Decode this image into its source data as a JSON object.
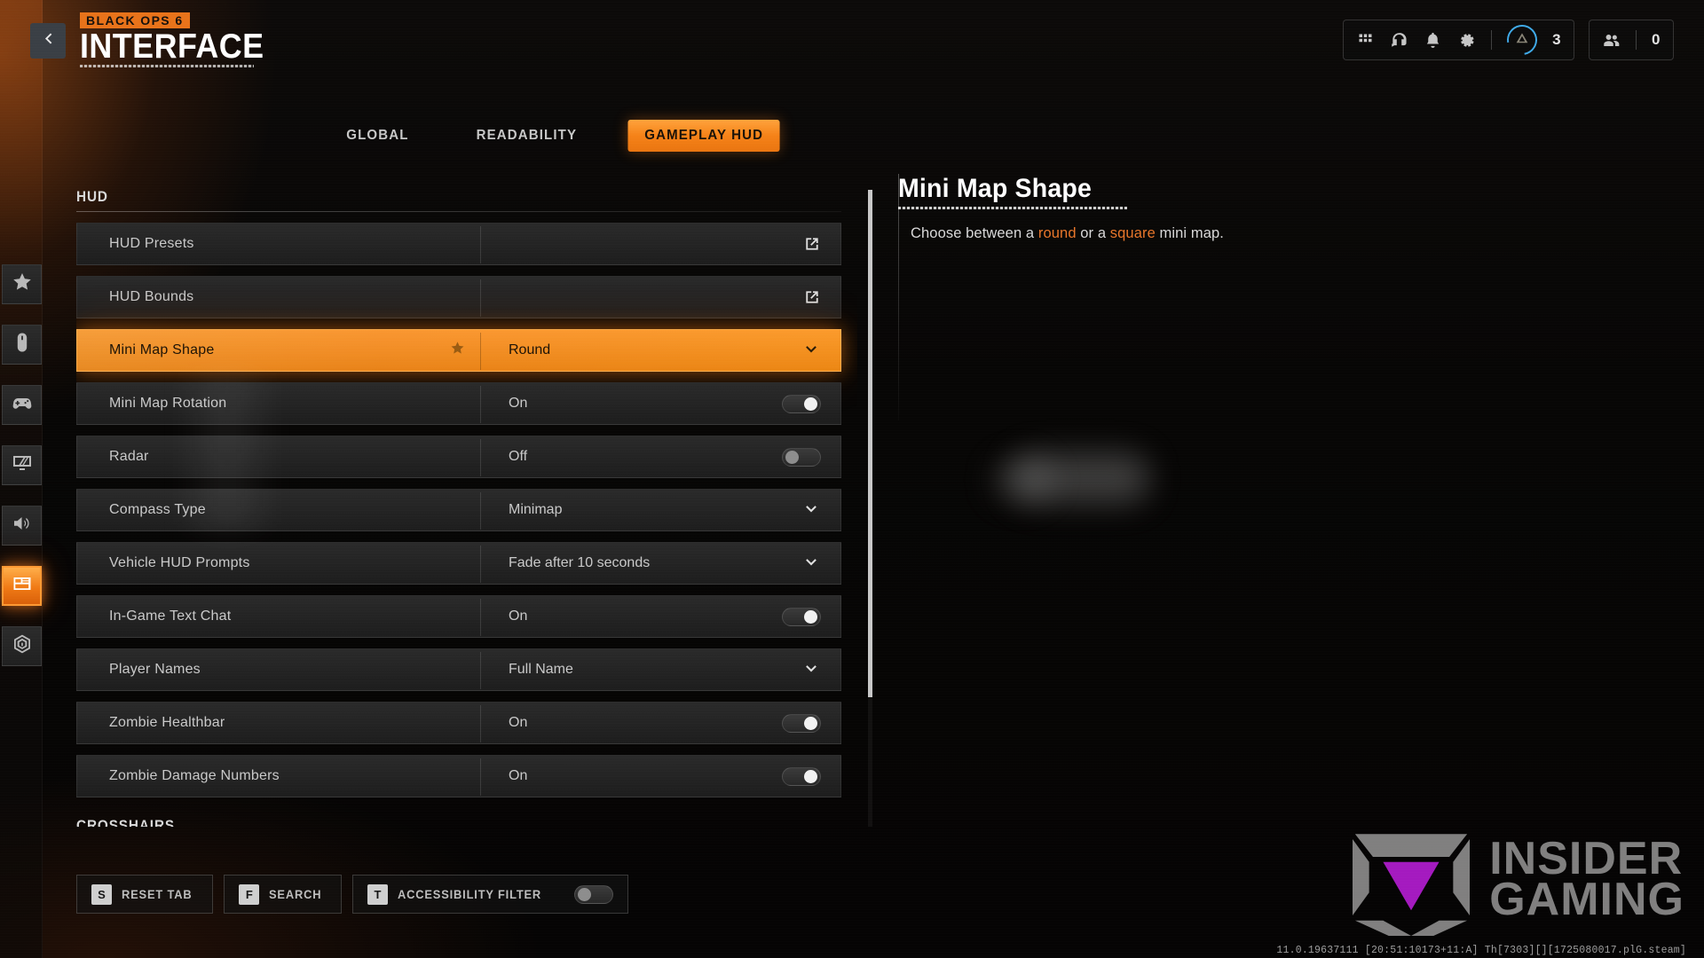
{
  "header": {
    "back_icon": "chevron-left-icon",
    "game_badge": "BLACK OPS 6",
    "page_title": "INTERFACE"
  },
  "top_right": {
    "icons": [
      {
        "name": "apps-grid-icon"
      },
      {
        "name": "headset-chat-icon"
      },
      {
        "name": "bell-notifications-icon"
      },
      {
        "name": "gear-settings-icon"
      }
    ],
    "battlepass_count": "3",
    "battlepass_icon": "battlepass-tier-icon",
    "friends_icon": "friends-people-icon",
    "friends_count": "0"
  },
  "tabs": [
    {
      "label": "GLOBAL",
      "active": false
    },
    {
      "label": "READABILITY",
      "active": false
    },
    {
      "label": "GAMEPLAY HUD",
      "active": true
    }
  ],
  "sidebar": {
    "items": [
      {
        "icon": "star-favorites-icon",
        "active": false
      },
      {
        "icon": "mouse-keyboard-icon",
        "active": false
      },
      {
        "icon": "controller-gamepad-icon",
        "active": false
      },
      {
        "icon": "monitor-graphics-icon",
        "active": false
      },
      {
        "icon": "speaker-audio-icon",
        "active": false
      },
      {
        "icon": "interface-layout-icon",
        "active": true
      },
      {
        "icon": "telemetry-radar-icon",
        "active": false
      }
    ]
  },
  "settings": {
    "section_title": "HUD",
    "next_section_title": "CROSSHAIRS",
    "rows": [
      {
        "label": "HUD Presets",
        "value": "",
        "control": "external-link",
        "starred": false,
        "highlight": false
      },
      {
        "label": "HUD Bounds",
        "value": "",
        "control": "external-link",
        "starred": false,
        "highlight": false
      },
      {
        "label": "Mini Map Shape",
        "value": "Round",
        "control": "dropdown",
        "starred": true,
        "highlight": true
      },
      {
        "label": "Mini Map Rotation",
        "value": "On",
        "control": "toggle-on",
        "starred": false,
        "highlight": false
      },
      {
        "label": "Radar",
        "value": "Off",
        "control": "toggle-off",
        "starred": false,
        "highlight": false
      },
      {
        "label": "Compass Type",
        "value": "Minimap",
        "control": "dropdown",
        "starred": false,
        "highlight": false
      },
      {
        "label": "Vehicle HUD Prompts",
        "value": "Fade after 10 seconds",
        "control": "dropdown",
        "starred": false,
        "highlight": false
      },
      {
        "label": "In-Game Text Chat",
        "value": "On",
        "control": "toggle-on",
        "starred": false,
        "highlight": false
      },
      {
        "label": "Player Names",
        "value": "Full Name",
        "control": "dropdown",
        "starred": false,
        "highlight": false
      },
      {
        "label": "Zombie Healthbar",
        "value": "On",
        "control": "toggle-on",
        "starred": false,
        "highlight": false
      },
      {
        "label": "Zombie Damage Numbers",
        "value": "On",
        "control": "toggle-on",
        "starred": false,
        "highlight": false
      }
    ]
  },
  "detail": {
    "title": "Mini Map Shape",
    "desc_pre": "Choose between a ",
    "desc_hl1": "round",
    "desc_mid": " or a ",
    "desc_hl2": "square",
    "desc_post": " mini map."
  },
  "bottom_bar": {
    "reset": {
      "key": "S",
      "label": "RESET TAB"
    },
    "search": {
      "key": "F",
      "label": "SEARCH"
    },
    "accessibility": {
      "key": "T",
      "label": "ACCESSIBILITY FILTER",
      "toggle": "off"
    }
  },
  "watermark": {
    "line1": "INSIDER",
    "line2": "GAMING",
    "logo_icon": "insider-gaming-logo-icon",
    "build_string": "11.0.19637111 [20:51:10173+11:A] Th[7303][][1725080017.plG.steam]"
  },
  "colors": {
    "accent_orange": "#f5821a",
    "badge_orange": "#e8731a",
    "ring_blue": "#3fa9e8",
    "logo_magenta": "#c81fe8"
  }
}
